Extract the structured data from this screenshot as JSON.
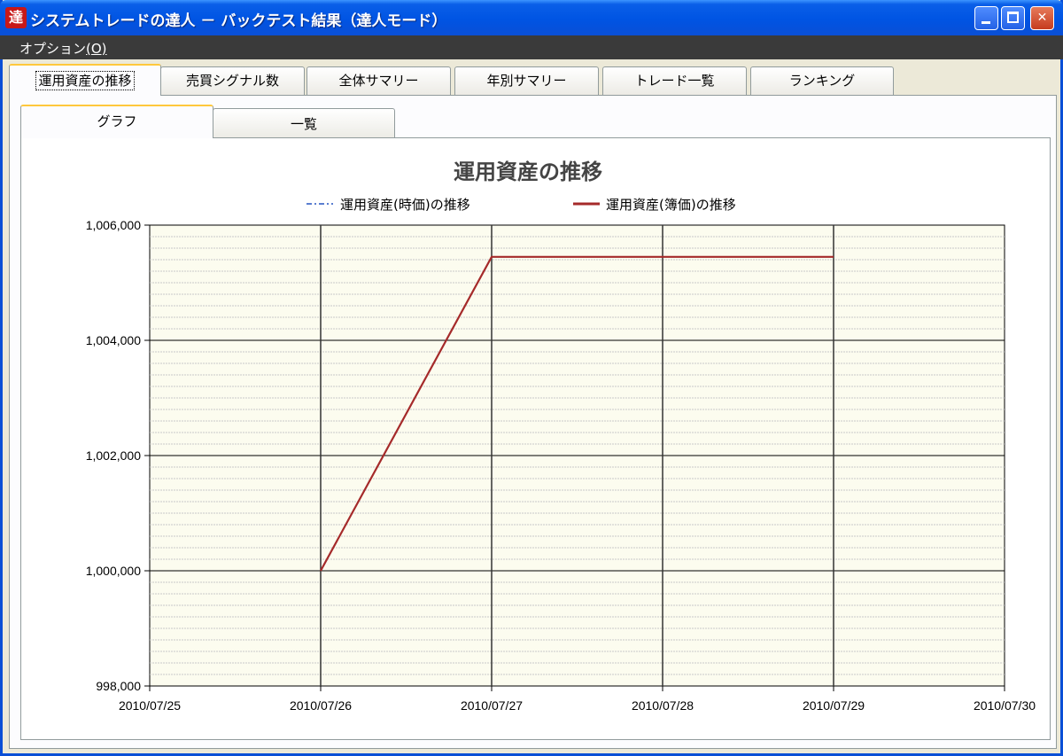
{
  "window": {
    "icon_glyph": "達",
    "title": "システムトレードの達人 － バックテスト結果（達人モード）",
    "controls": {
      "minimize_icon": "minimize-icon",
      "maximize_icon": "maximize-icon",
      "close_icon": "close-icon",
      "close_glyph": "✕"
    }
  },
  "menu": {
    "option_label": "オプション",
    "option_mnemonic": "(O)"
  },
  "tabs": [
    {
      "label": "運用資産の推移",
      "active": true
    },
    {
      "label": "売買シグナル数",
      "active": false
    },
    {
      "label": "全体サマリー",
      "active": false
    },
    {
      "label": "年別サマリー",
      "active": false
    },
    {
      "label": "トレード一覧",
      "active": false
    },
    {
      "label": "ランキング",
      "active": false
    }
  ],
  "subtabs": [
    {
      "label": "グラフ",
      "active": true
    },
    {
      "label": "一覧",
      "active": false
    }
  ],
  "colors": {
    "plot_background": "#fcfcef",
    "line_book_value": "#a52a2a",
    "line_market_value": "#5b7fd0",
    "grid_major": "#000000",
    "grid_minor": "#c8c8c8",
    "accent_tab": "#ffc83c"
  },
  "chart_data": {
    "type": "line",
    "title": "運用資産の推移",
    "x": [
      "2010/07/25",
      "2010/07/26",
      "2010/07/27",
      "2010/07/28",
      "2010/07/29",
      "2010/07/30"
    ],
    "xlim": [
      "2010/07/25",
      "2010/07/30"
    ],
    "ylim": [
      998000,
      1006000
    ],
    "yticks": [
      998000,
      1000000,
      1002000,
      1004000,
      1006000
    ],
    "ytick_labels": [
      "998,000",
      "1,000,000",
      "1,002,000",
      "1,004,000",
      "1,006,000"
    ],
    "grid": true,
    "legend_position": "top",
    "series": [
      {
        "name": "運用資産(時価)の推移",
        "style": "dash-dot",
        "values": []
      },
      {
        "name": "運用資産(簿価)の推移",
        "style": "solid",
        "points": [
          {
            "x": "2010/07/26",
            "y": 1000000
          },
          {
            "x": "2010/07/27",
            "y": 1005450
          },
          {
            "x": "2010/07/28",
            "y": 1005450
          },
          {
            "x": "2010/07/29",
            "y": 1005450
          }
        ]
      }
    ]
  }
}
